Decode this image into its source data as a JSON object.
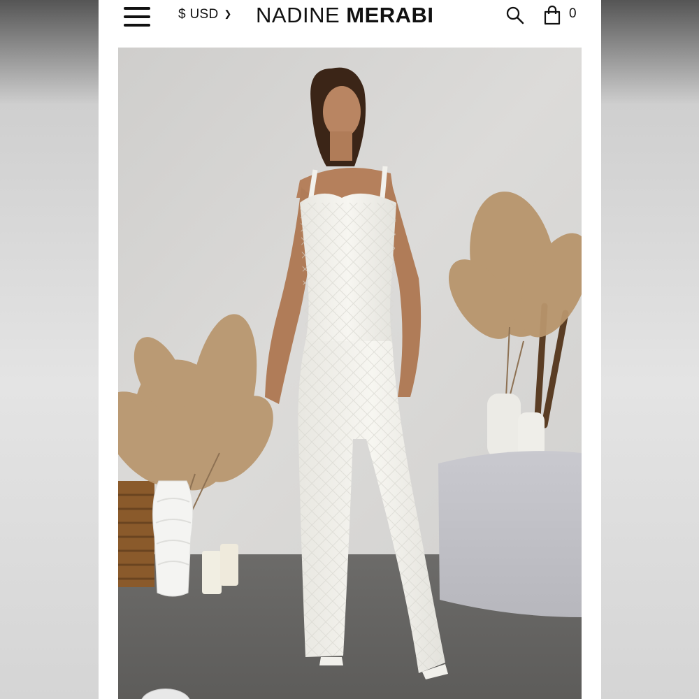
{
  "header": {
    "currency_label": "$ USD",
    "brand_light": "NADINE ",
    "brand_bold": "MERABI",
    "cart_count": "0"
  },
  "icons": {
    "menu": "hamburger-menu-icon",
    "currency_dropdown": "chevron-down-icon",
    "search": "search-icon",
    "cart": "shopping-bag-icon"
  },
  "colors": {
    "text": "#111111",
    "background": "#ffffff",
    "wall": "#d9d8d6",
    "floor": "#6e6d6b",
    "garment": "#f4f3ee",
    "pampas": "#b69670"
  }
}
